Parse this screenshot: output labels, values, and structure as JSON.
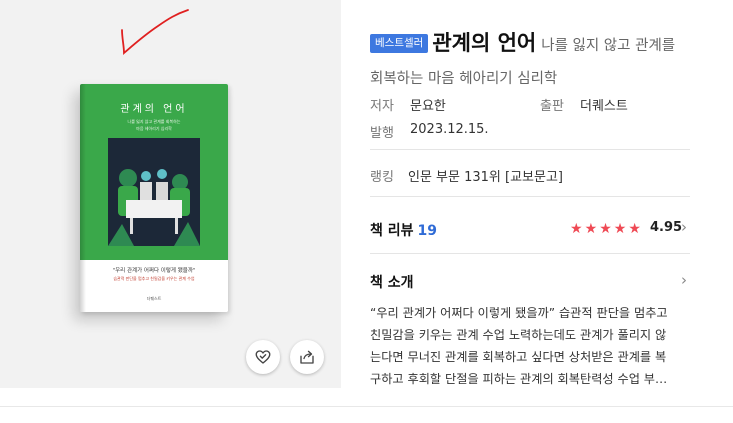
{
  "product": {
    "badge": "베스트셀러",
    "title": "관계의 언어",
    "subtitle": "나를 잃지 않고 관계를 회복하는 마음 헤아리기 심리학",
    "meta": {
      "author_label": "저자",
      "author": "문요한",
      "publisher_label": "출판",
      "publisher": "더퀘스트",
      "date_label": "발행",
      "date": "2023.12.15.",
      "ranking_label": "랭킹",
      "ranking": "인문 부문 131위 [교보문고]"
    }
  },
  "cover": {
    "title": "관계의 언어",
    "sub_line1": "나를 잃지 않고 관계를 회복하는",
    "sub_line2": "마음 헤아리기 심리학",
    "quote": "\"우리 관계가 어쩌다 이렇게 됐을까\"",
    "tagline": "습관적 판단을 멈추고 친밀감을 키우는 관계 수업",
    "publisher_mark": "더퀘스트"
  },
  "review": {
    "label": "책 리뷰",
    "count": "19",
    "rating": "4.95",
    "stars": 4.95
  },
  "intro": {
    "label": "책 소개",
    "lines": [
      "“우리 관계가 어쩌다 이렇게 됐을까” 습관적 판단을 멈추고",
      "친밀감을 키우는 관계 수업 노력하는데도 관계가 풀리지 않",
      "는다면 무너진 관계를 회복하고 싶다면 상처받은 관계를 복",
      "구하고 후회할 단절을 피하는 관계의 회복탄력성 수업 부…"
    ]
  },
  "icons": {
    "heart": "heart-check-icon",
    "share": "share-icon",
    "chevron": "chevron-right-icon"
  },
  "colors": {
    "badge": "#3d78e0",
    "cover_green": "#3aa84a",
    "star": "#ef4a55",
    "review_count": "#2f6bd6",
    "annotation": "#e02020"
  }
}
